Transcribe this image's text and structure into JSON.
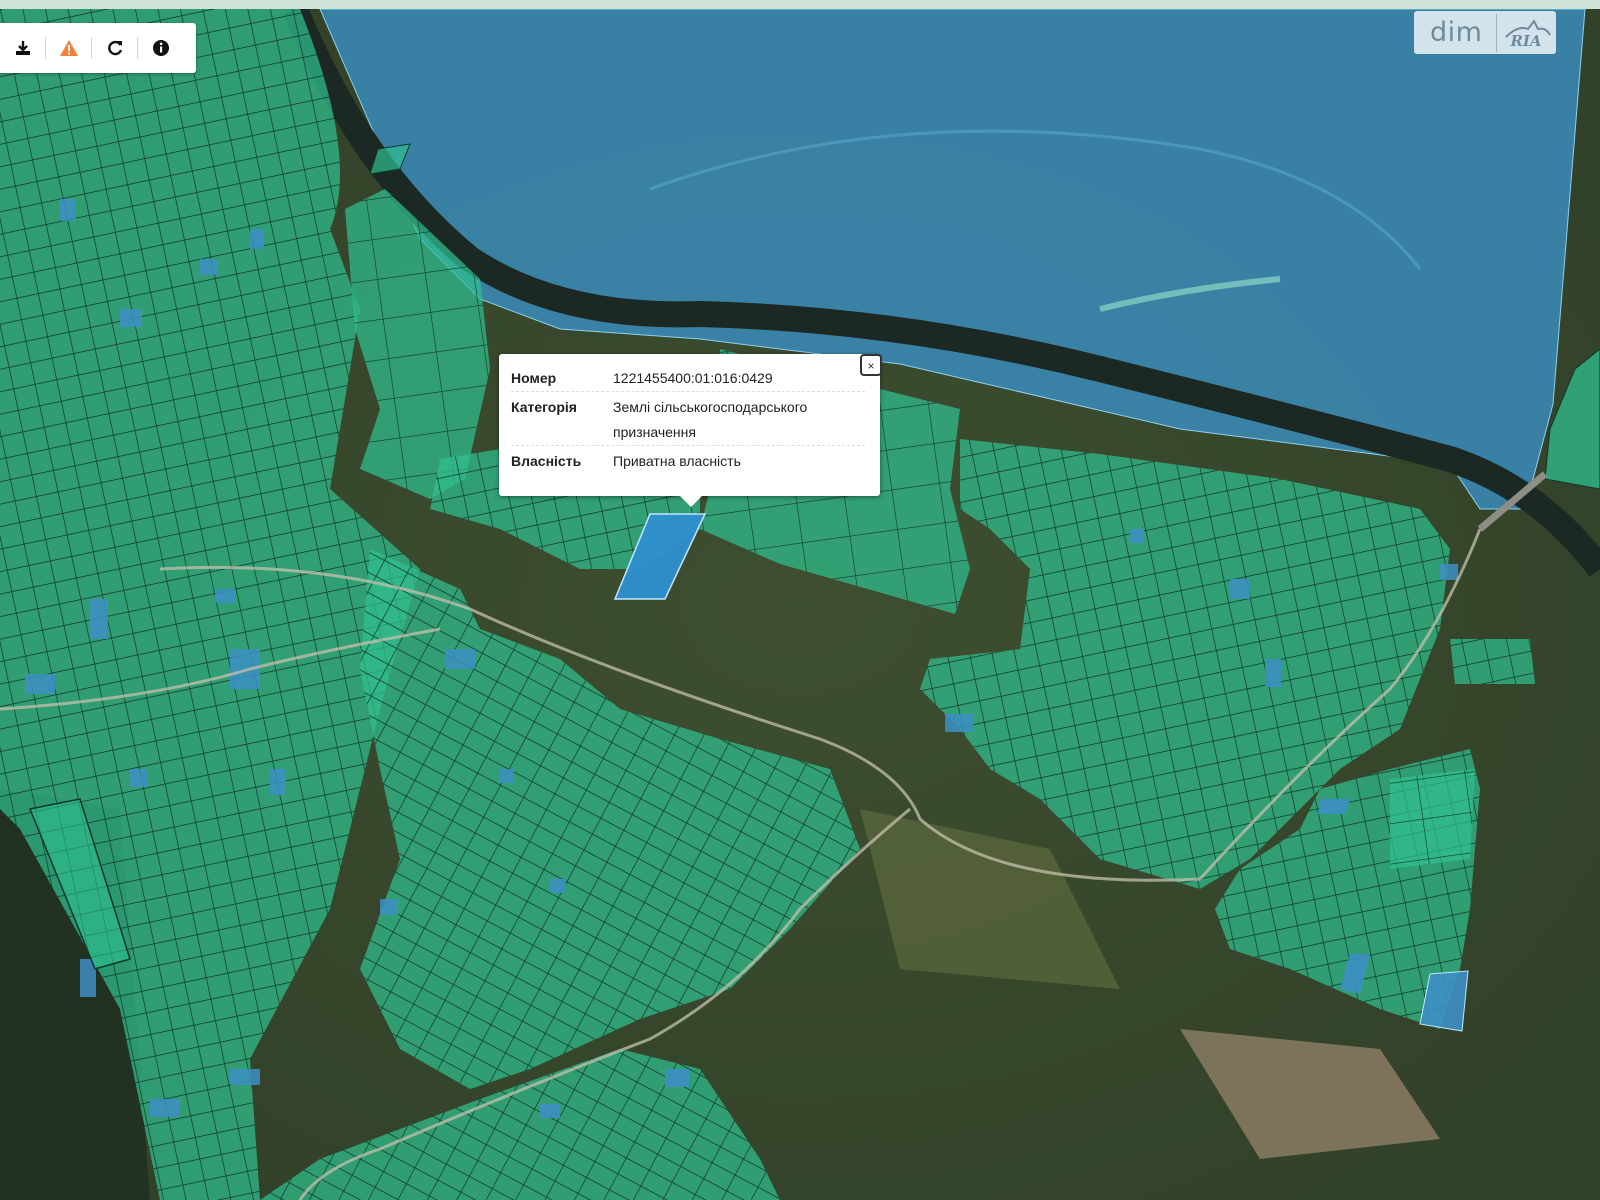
{
  "toolbar": {
    "buttons": [
      {
        "name": "download-icon",
        "icon": "download"
      },
      {
        "name": "warning-icon",
        "icon": "warning",
        "color": "#f0813a"
      },
      {
        "name": "refresh-icon",
        "icon": "refresh"
      },
      {
        "name": "info-icon",
        "icon": "info"
      }
    ]
  },
  "brand": {
    "text": "dim",
    "logo_text": "RIA"
  },
  "popup": {
    "rows": [
      {
        "key": "Номер",
        "value": "1221455400:01:016:0429"
      },
      {
        "key": "Категорія",
        "value": "Землі сільськогосподарського призначення"
      },
      {
        "key": "Власність",
        "value": "Приватна власність"
      }
    ],
    "close_label": "×"
  },
  "map": {
    "colors": {
      "parcel_green": "#2fbf8f",
      "parcel_blue": "#3d8fc4",
      "river_zone": "#3b8fc0",
      "river": "#1e2a24"
    }
  }
}
